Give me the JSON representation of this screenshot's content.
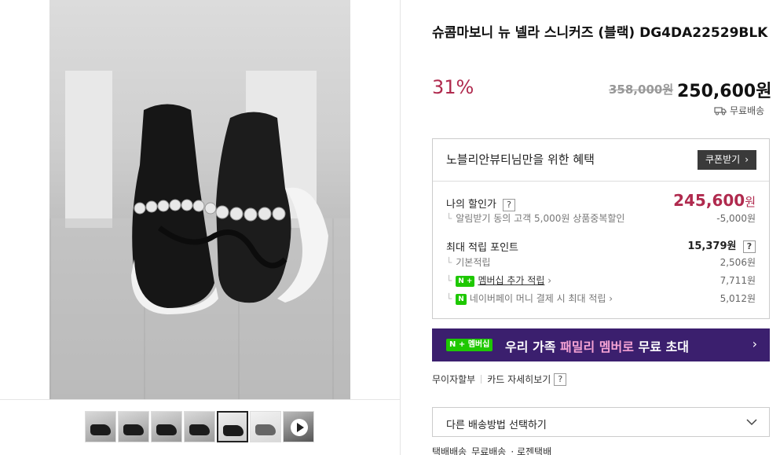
{
  "product": {
    "title": "슈콤마보니 뉴 넬라 스니커즈 (블랙) DG4DA22529BLK",
    "discount_rate": "31%",
    "original_price": "358,000원",
    "price": "250,600원",
    "shipping": "무료배송"
  },
  "gallery": {
    "prev_icon": "chevron-left-icon",
    "next_icon": "chevron-right-icon",
    "thumbnails_count": 7,
    "active_thumbnail": 5
  },
  "benefit": {
    "title": "노블리안뷰티님만을 위한 혜택",
    "coupon_button": "쿠폰받기",
    "my_discount_label": "나의 할인가",
    "my_discount_price": "245,600",
    "my_discount_won": "원",
    "alarm_label": "알림받기 동의 고객 5,000원 상품중복할인",
    "alarm_value": "-5,000원",
    "max_points_label": "최대 적립 포인트",
    "max_points_value": "15,379원",
    "basic_label": "기본적립",
    "basic_value": "2,506원",
    "membership_badge": "N +",
    "membership_label": "멤버십 추가 적립",
    "membership_value": "7,711원",
    "npay_badge": "N",
    "npay_label": "네이버페이 머니 결제 시 최대 적립",
    "npay_value": "5,012원",
    "help": "?"
  },
  "banner": {
    "badge": "N + 멤버십",
    "text_prefix": "우리 가족",
    "text_highlight": "패밀리 멤버로",
    "text_suffix": "무료 초대",
    "arrow": "›"
  },
  "links": {
    "installment": "무이자할부",
    "card_detail": "카드 자세히보기",
    "help": "?"
  },
  "delivery_select": {
    "label": "다른 배송방법 선택하기"
  },
  "shipping_options": {
    "a": "택배배송",
    "b": "무료배송",
    "c": "· 로젠택배"
  },
  "colors": {
    "accent": "#b02a4e",
    "banner_bg": "#3b1f6e",
    "npay_green": "#1ec800"
  }
}
